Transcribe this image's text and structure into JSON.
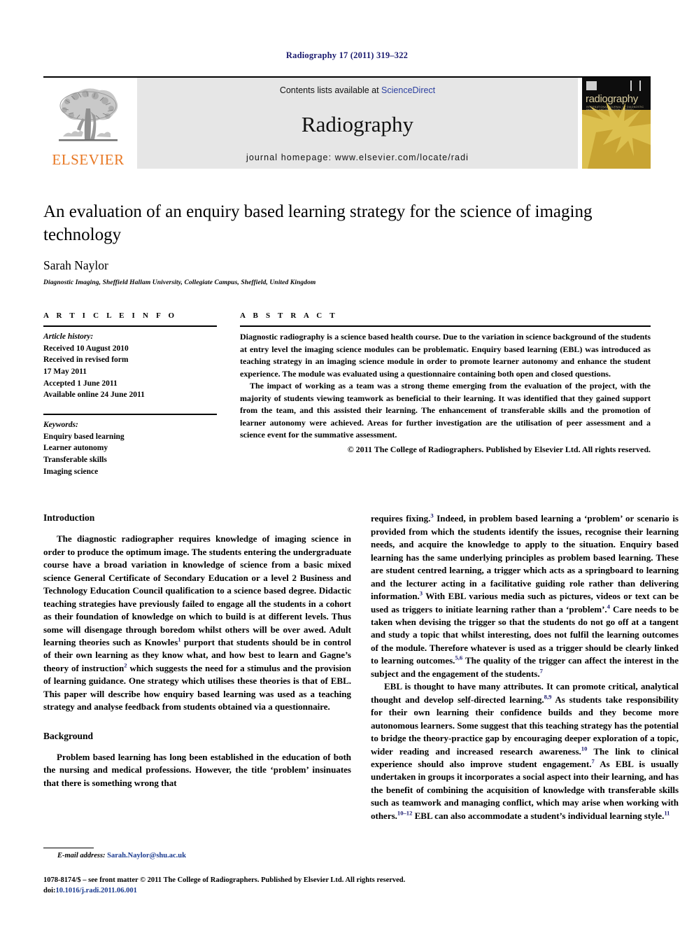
{
  "running_head": "Radiography 17 (2011) 319–322",
  "masthead": {
    "publisher_name": "ELSEVIER",
    "publisher_logo_icon": "elsevier-tree-icon",
    "contents_prefix": "Contents lists available at ",
    "contents_link": "ScienceDirect",
    "journal_name": "Radiography",
    "homepage_line": "journal homepage: www.elsevier.com/locate/radi",
    "cover": {
      "title": "radiography",
      "subtitle": "INTERNATIONAL JOURNAL OF DIAGNOSTIC IMAGING AND RADIATION THERAPY",
      "accent_color": "#c8a433"
    }
  },
  "article": {
    "title": "An evaluation of an enquiry based learning strategy for the science of imaging technology",
    "author": "Sarah Naylor",
    "affiliation": "Diagnostic Imaging, Sheffield Hallam University, Collegiate Campus, Sheffield, United Kingdom"
  },
  "article_info": {
    "heading": "A R T I C L E   I N F O",
    "history_label": "Article history:",
    "history": [
      "Received 10 August 2010",
      "Received in revised form",
      "17 May 2011",
      "Accepted 1 June 2011",
      "Available online 24 June 2011"
    ],
    "keywords_label": "Keywords:",
    "keywords": [
      "Enquiry based learning",
      "Learner autonomy",
      "Transferable skills",
      "Imaging science"
    ]
  },
  "abstract": {
    "heading": "A B S T R A C T",
    "paragraphs": [
      "Diagnostic radiography is a science based health course. Due to the variation in science background of the students at entry level the imaging science modules can be problematic. Enquiry based learning (EBL) was introduced as teaching strategy in an imaging science module in order to promote learner autonomy and enhance the student experience. The module was evaluated using a questionnaire containing both open and closed questions.",
      "The impact of working as a team was a strong theme emerging from the evaluation of the project, with the majority of students viewing teamwork as beneficial to their learning. It was identified that they gained support from the team, and this assisted their learning. The enhancement of transferable skills and the promotion of learner autonomy were achieved. Areas for further investigation are the utilisation of peer assessment and a science event for the summative assessment."
    ],
    "copyright": "© 2011 The College of Radiographers. Published by Elsevier Ltd. All rights reserved."
  },
  "body": {
    "left": {
      "heading_1": "Introduction",
      "intro_p1_a": "The diagnostic radiographer requires knowledge of imaging science in order to produce the optimum image. The students entering the undergraduate course have a broad variation in knowledge of science from a basic mixed science General Certificate of Secondary Education or a level 2 Business and Technology Education Council qualification to a science based degree. Didactic teaching strategies have previously failed to engage all the students in a cohort as their foundation of knowledge on which to build is at different levels. Thus some will disengage through boredom whilst others will be over awed. Adult learning theories such as Knowles",
      "ref_1": "1",
      "intro_p1_b": " purport that students should be in control of their own learning as they know what, and how best to learn and Gagne’s theory of instruction",
      "ref_2": "2",
      "intro_p1_c": " which suggests the need for a stimulus and the provision of learning guidance. One strategy which utilises these theories is that of EBL. This paper will describe how enquiry based learning was used as a teaching strategy and analyse feedback from students obtained via a questionnaire.",
      "heading_2": "Background",
      "background_p1": "Problem based learning has long been established in the education of both the nursing and medical professions. However, the title ‘problem’ insinuates that there is something wrong that"
    },
    "right": {
      "p1_a": "requires fixing.",
      "p1_ref_3": "3",
      "p1_b": " Indeed, in problem based learning a ‘problem’ or scenario is provided from which the students identify the issues, recognise their learning needs, and acquire the knowledge to apply to the situation. Enquiry based learning has the same underlying principles as problem based learning. These are student centred learning, a trigger which acts as a springboard to learning and the lecturer acting in a facilitative guiding role rather than delivering information.",
      "p1_ref_3b": "3",
      "p1_c": " With EBL various media such as pictures, videos or text can be used as triggers to initiate learning rather than a ‘problem’.",
      "p1_ref_4": "4",
      "p1_d": " Care needs to be taken when devising the trigger so that the students do not go off at a tangent and study a topic that whilst interesting, does not fulfil the learning outcomes of the module. Therefore whatever is used as a trigger should be clearly linked to learning outcomes.",
      "p1_ref_56": "5,6",
      "p1_e": " The quality of the trigger can affect the interest in the subject and the engagement of the students.",
      "p1_ref_7": "7",
      "p2_a": "EBL is thought to have many attributes. It can promote critical, analytical thought and develop self-directed learning.",
      "p2_ref_89": "8,9",
      "p2_b": " As students take responsibility for their own learning their confidence builds and they become more autonomous learners. Some suggest that this teaching strategy has the potential to bridge the theory-practice gap by encouraging deeper exploration of a topic, wider reading and increased research awareness.",
      "p2_ref_10": "10",
      "p2_c": " The link to clinical experience should also improve student engagement.",
      "p2_ref_7": "7",
      "p2_d": " As EBL is usually undertaken in groups it incorporates a social aspect into their learning, and has the benefit of combining the acquisition of knowledge with transferable skills such as teamwork and managing conflict, which may arise when working with others.",
      "p2_ref_1012": "10–12",
      "p2_e": " EBL can also accommodate a student’s individual learning style.",
      "p2_ref_11": "11"
    }
  },
  "footer": {
    "email_label": "E-mail address:",
    "email_address": "Sarah.Naylor@shu.ac.uk",
    "issn_line": "1078-8174/$ – see front matter © 2011 The College of Radiographers. Published by Elsevier Ltd. All rights reserved.",
    "doi_label": "doi:",
    "doi_value": "10.1016/j.radi.2011.06.001"
  }
}
